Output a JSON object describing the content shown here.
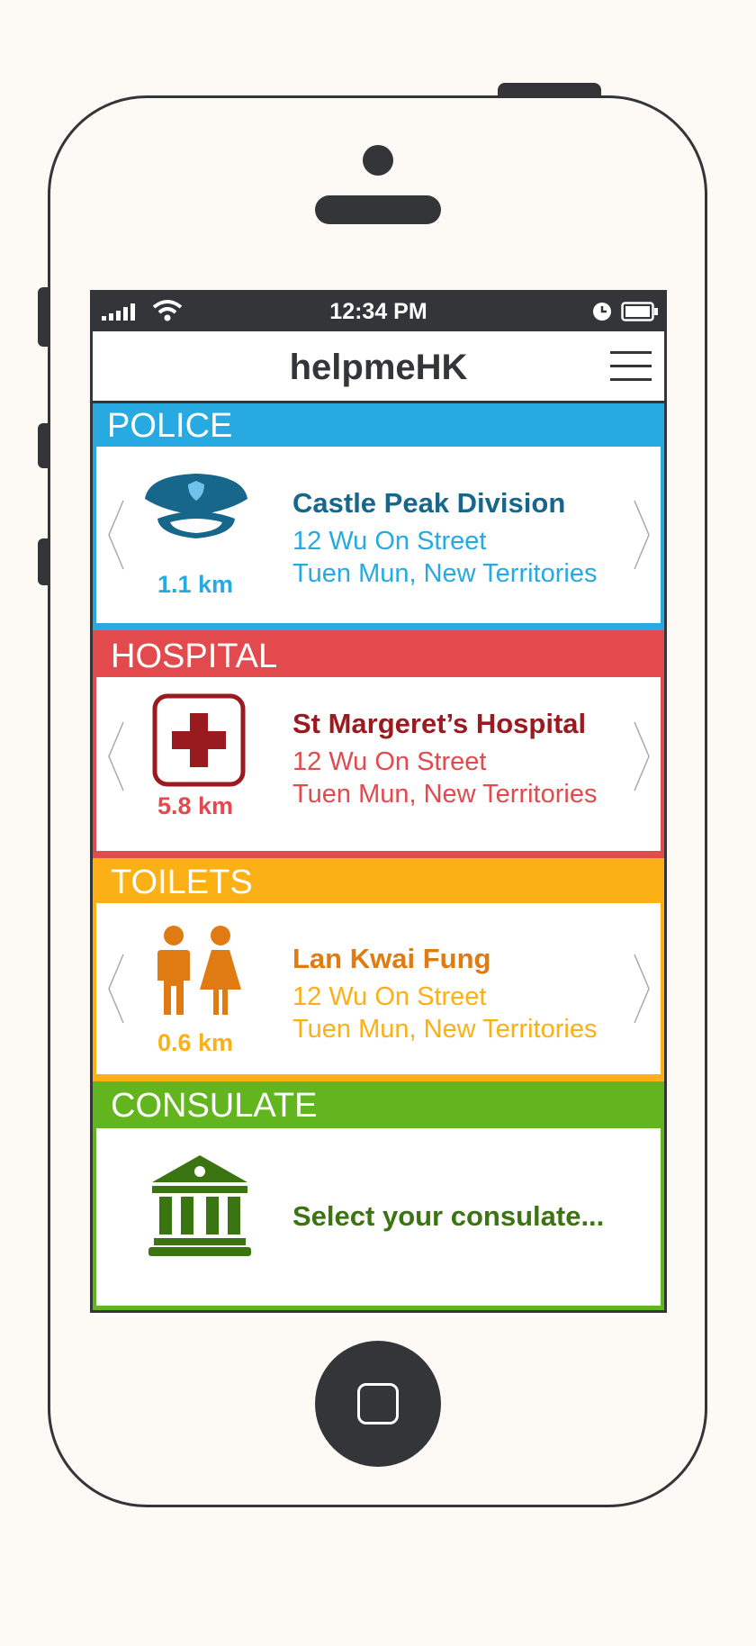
{
  "statusbar": {
    "time": "12:34 PM"
  },
  "navbar": {
    "title": "helpmeHK"
  },
  "colors": {
    "frame": "#343539",
    "police": "#27a9e1",
    "police_dark": "#17668c",
    "hospital": "#e24a4d",
    "hospital_dark": "#9a1b1f",
    "toilets": "#fbb016",
    "toilets_dark": "#e07a12",
    "consulate": "#63b520",
    "consulate_dark": "#3b7512"
  },
  "sections": {
    "police": {
      "header": "POLICE",
      "distance": "1.1 km",
      "name": "Castle Peak Division",
      "address_line1": "12 Wu On Street",
      "address_line2": "Tuen Mun, New Territories",
      "icon": "police-cap-icon"
    },
    "hospital": {
      "header": "HOSPITAL",
      "distance": "5.8 km",
      "name": "St Margeret’s Hospital",
      "address_line1": "12 Wu On Street",
      "address_line2": "Tuen Mun, New Territories",
      "icon": "hospital-cross-icon"
    },
    "toilets": {
      "header": "TOILETS",
      "distance": "0.6 km",
      "name": "Lan Kwai Fung",
      "address_line1": "12 Wu On Street",
      "address_line2": "Tuen Mun, New Territories",
      "icon": "toilet-people-icon"
    },
    "consulate": {
      "header": "CONSULATE",
      "prompt": "Select your consulate...",
      "icon": "consulate-building-icon"
    }
  }
}
